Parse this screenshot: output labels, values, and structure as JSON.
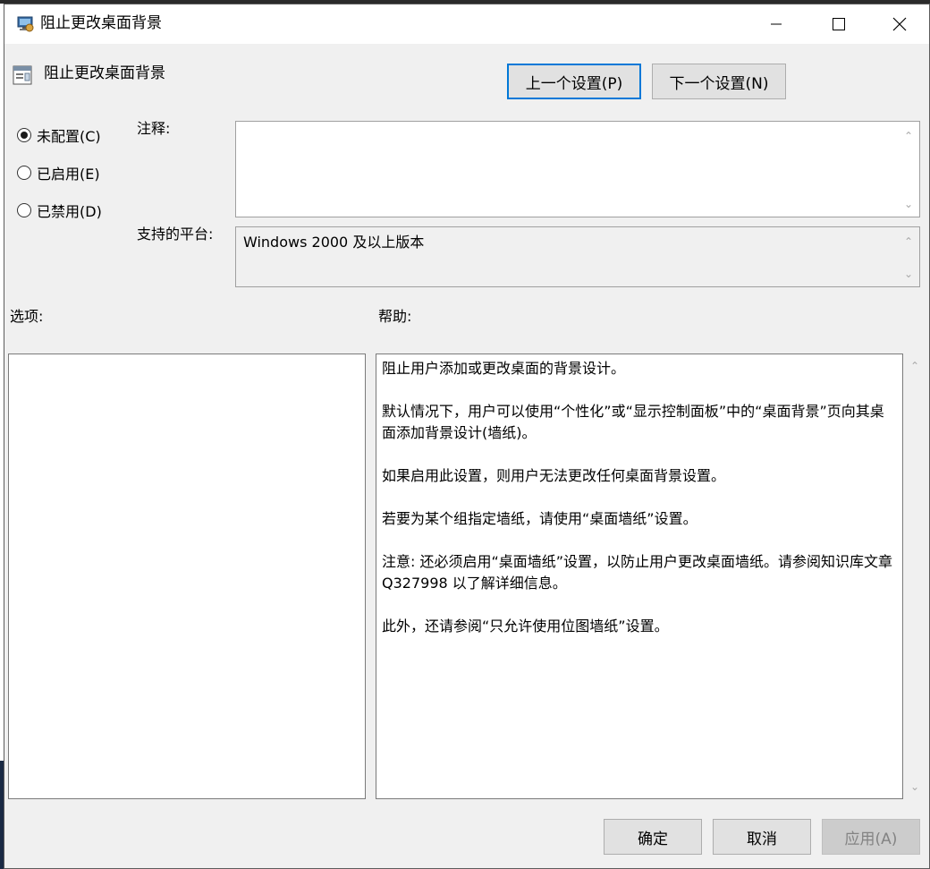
{
  "window": {
    "title": "阻止更改桌面背景",
    "controls": {
      "minimize_icon": "minimize-icon",
      "maximize_icon": "maximize-icon",
      "close_icon": "close-icon"
    }
  },
  "header": {
    "policy_title": "阻止更改桌面背景",
    "prev_label": "上一个设置(P)",
    "next_label": "下一个设置(N)"
  },
  "state": {
    "options": [
      {
        "label": "未配置(C)",
        "checked": true
      },
      {
        "label": "已启用(E)",
        "checked": false
      },
      {
        "label": "已禁用(D)",
        "checked": false
      }
    ]
  },
  "comment": {
    "label": "注释:",
    "value": ""
  },
  "platform": {
    "label": "支持的平台:",
    "value": "Windows 2000 及以上版本"
  },
  "options_panel": {
    "label": "选项:"
  },
  "help_panel": {
    "label": "帮助:",
    "paragraphs": [
      "阻止用户添加或更改桌面的背景设计。",
      "默认情况下，用户可以使用“个性化”或“显示控制面板”中的“桌面背景”页向其桌面添加背景设计(墙纸)。",
      "如果启用此设置，则用户无法更改任何桌面背景设置。",
      "若要为某个组指定墙纸，请使用“桌面墙纸”设置。",
      "注意: 还必须启用“桌面墙纸”设置，以防止用户更改桌面墙纸。请参阅知识库文章 Q327998 以了解详细信息。",
      "此外，还请参阅“只允许使用位图墙纸”设置。"
    ]
  },
  "footer": {
    "ok_label": "确定",
    "cancel_label": "取消",
    "apply_label": "应用(A)"
  },
  "colors": {
    "accent": "#0078d7",
    "background": "#f0f0f0"
  }
}
